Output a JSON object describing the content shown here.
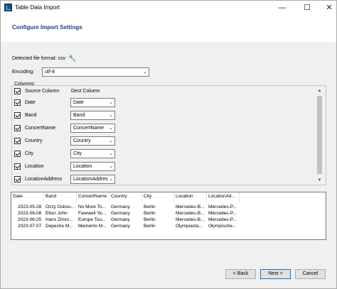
{
  "window": {
    "title": "Table Data Import"
  },
  "header": {
    "title": "Configure Import Settings"
  },
  "file_format": {
    "label": "Detected file format: csv"
  },
  "encoding": {
    "label": "Encoding:",
    "value": "utf-8"
  },
  "columns": {
    "label": "Columns:",
    "source_header": "Source Column",
    "dest_header": "Dest Column",
    "rows": [
      {
        "source": "Date",
        "dest": "Date",
        "checked": true
      },
      {
        "source": "Band",
        "dest": "Band",
        "checked": true
      },
      {
        "source": "ConcertName",
        "dest": "ConcertName",
        "checked": true
      },
      {
        "source": "Country",
        "dest": "Country",
        "checked": true
      },
      {
        "source": "City",
        "dest": "City",
        "checked": true
      },
      {
        "source": "Location",
        "dest": "Location",
        "checked": true
      },
      {
        "source": "LocationAddress",
        "dest": "LocationAddres",
        "checked": true
      }
    ]
  },
  "preview": {
    "headers": [
      "Date",
      "Band",
      "ConcertName",
      "Country",
      "City",
      "Location",
      "LocationAd..."
    ],
    "rows": [
      [
        "2023-05-28",
        "Ozzy Osbou...",
        "No More To...",
        "Germany",
        "Berlin",
        "Mercedes-B...",
        "Mercedes-P..."
      ],
      [
        "2023-06-08",
        "Elton John",
        "Farewell Ye...",
        "Germany",
        "Berlin",
        "Mercedes-B...",
        "Mercedes-P..."
      ],
      [
        "2023-06-25",
        "Hans Zimm...",
        "Europe Tou...",
        "Germany",
        "Berlin",
        "Mercedes-B...",
        "Mercedes-P..."
      ],
      [
        "2023-07-07",
        "Depeche M...",
        "Memento M...",
        "Germany",
        "Berlin",
        "Olympiasta...",
        "Olympische..."
      ]
    ]
  },
  "buttons": {
    "back": "< Back",
    "next": "Next >",
    "cancel": "Cancel"
  }
}
